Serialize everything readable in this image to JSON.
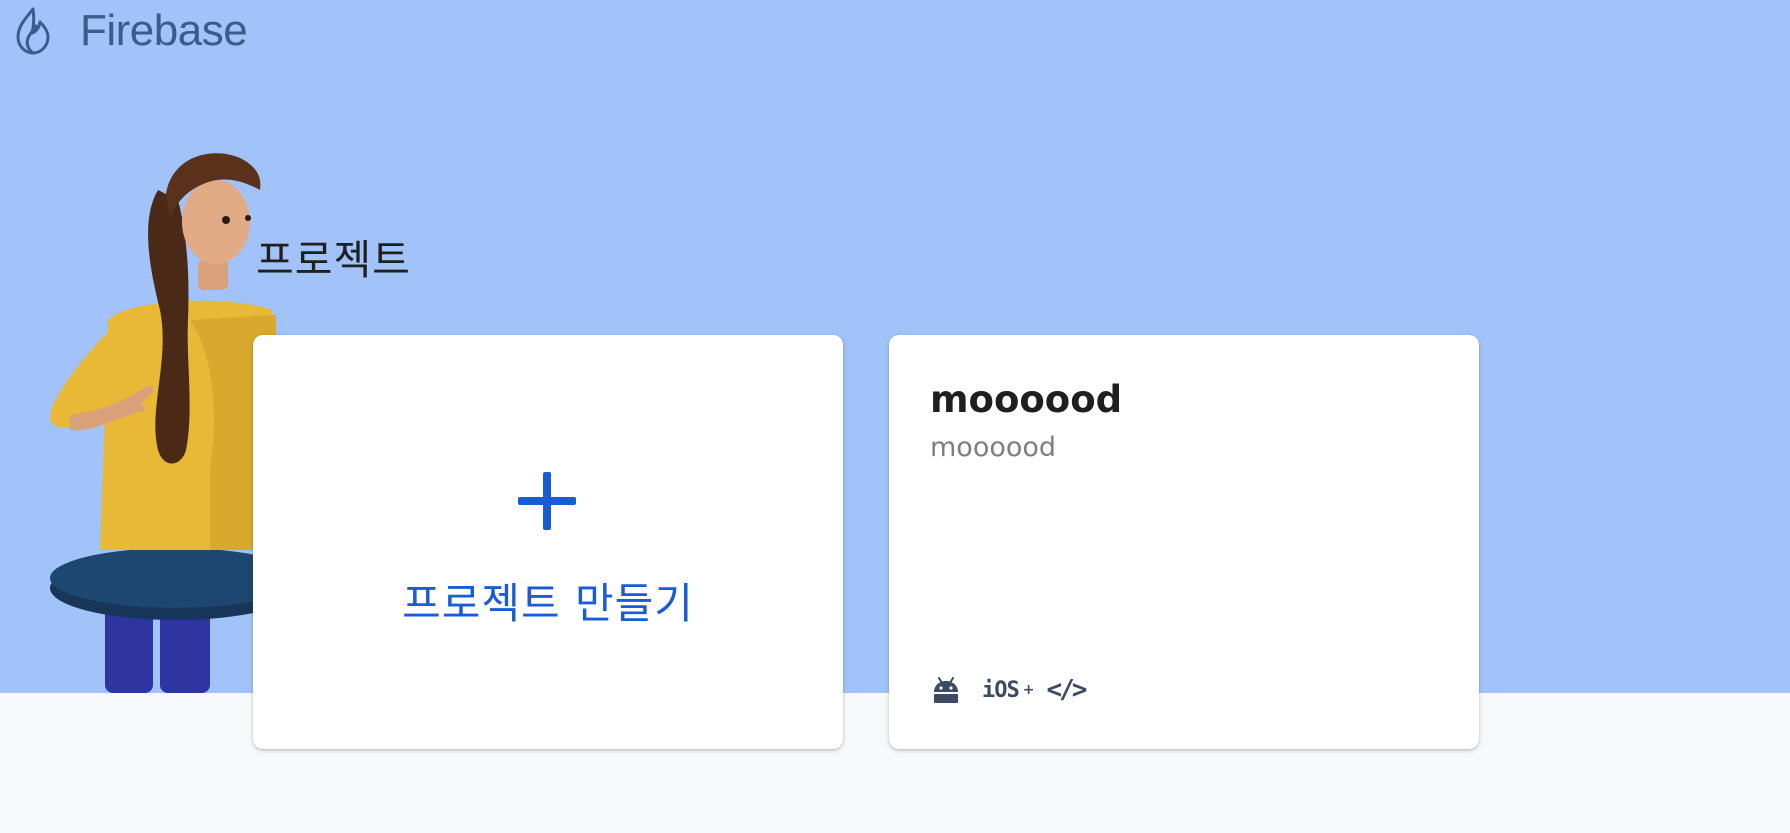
{
  "header": {
    "brand_name": "Firebase",
    "logo_icon": "firebase-flame-icon"
  },
  "hero": {
    "background_color": "#a1c3f9",
    "illustration": "person-at-table-illustration",
    "section_title": "프로젝트"
  },
  "create_card": {
    "icon": "plus-icon",
    "label": "프로젝트 만들기",
    "accent_color": "#1a5bd6"
  },
  "projects": [
    {
      "name": "moooood",
      "project_id": "moooood",
      "platforms": [
        {
          "icon": "android-icon"
        },
        {
          "icon": "ios-icon",
          "label": "iOS",
          "suffix": "+"
        },
        {
          "icon": "web-code-icon",
          "label": "</>"
        }
      ]
    }
  ]
}
